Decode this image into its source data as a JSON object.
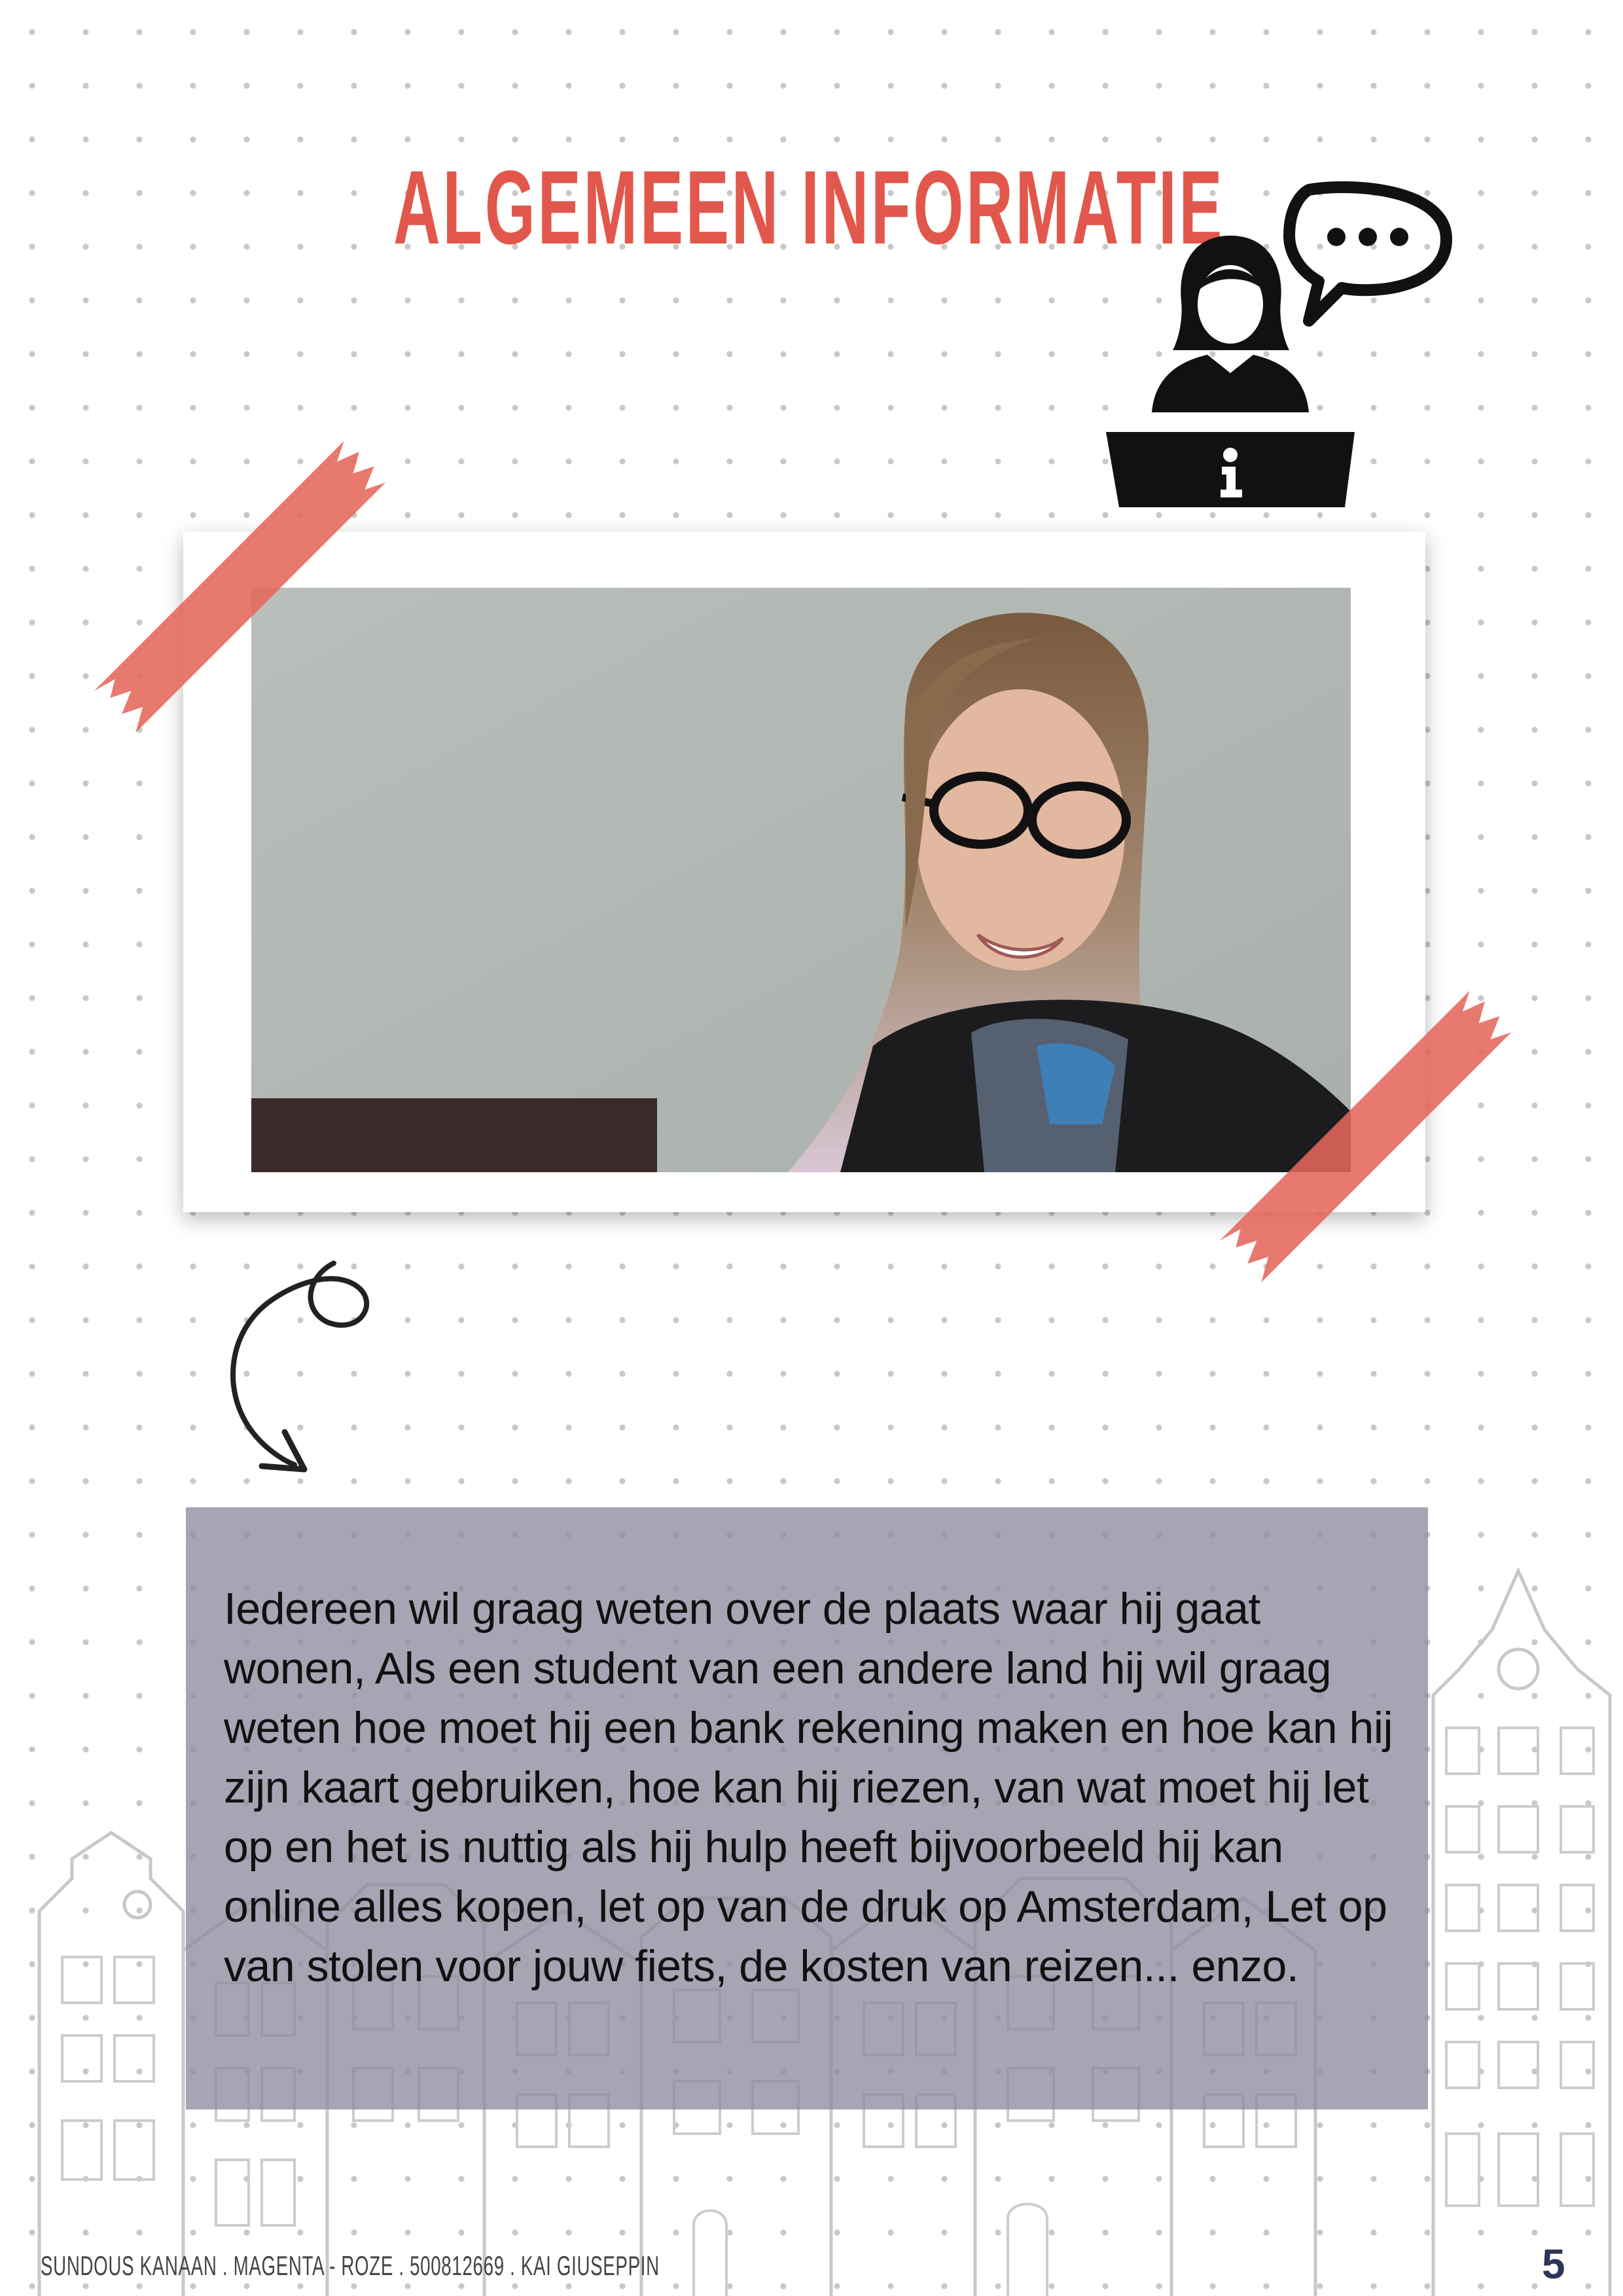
{
  "page": {
    "title": "ALGEMEEN INFORMATIE",
    "body_text": "Iedereen wil graag weten over de plaats waar hij gaat wonen, Als een student van een andere land hij wil graag weten hoe moet hij een bank rekening maken en hoe kan hij zijn kaart gebruiken, hoe kan hij riezen, van wat moet hij let op en het is nuttig als hij hulp heeft bijvoorbeeld hij kan online alles kopen, let op van de druk op Amsterdam, Let op van stolen voor jouw fiets, de kosten van reizen... enzo.",
    "footer": "SUNDOUS KANAAN . MAGENTA - ROZE . 500812669 . KAI GIUSEPPIN",
    "page_number": "5",
    "info_icon_glyph": "i"
  },
  "icons": {
    "info_desk": "info-desk-person-icon",
    "speech": "speech-bubble-icon",
    "arrow": "curly-arrow-icon"
  },
  "colors": {
    "accent": "#e2574c",
    "tape": "#e5675b",
    "text_box": "#8c8c9e",
    "page_number": "#2e3558"
  }
}
